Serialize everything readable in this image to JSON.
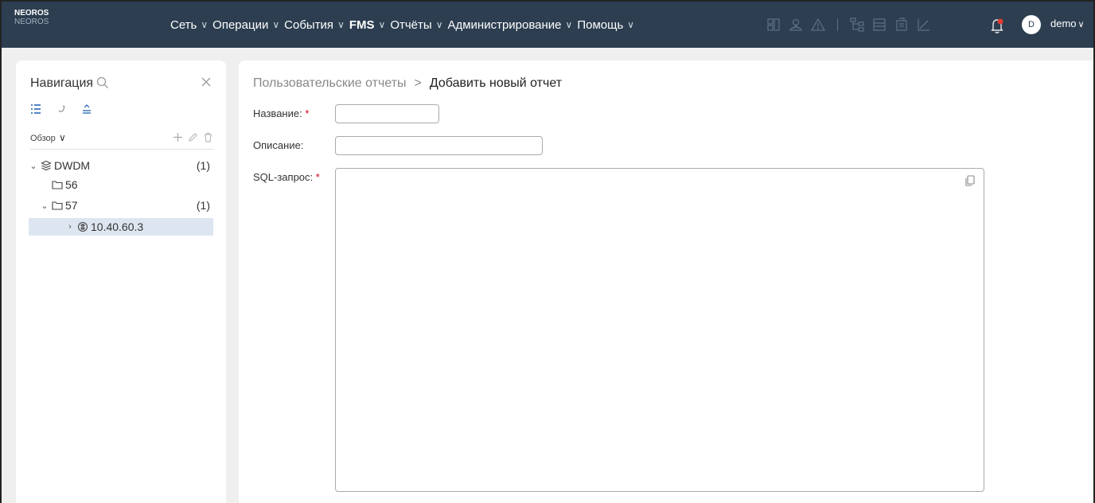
{
  "brand": {
    "title": "NEOROS",
    "subtitle": "NEOROS"
  },
  "menu": [
    {
      "label": "Сеть",
      "bold": false
    },
    {
      "label": "Операции",
      "bold": false
    },
    {
      "label": "События",
      "bold": false
    },
    {
      "label": "FMS",
      "bold": true
    },
    {
      "label": "Отчёты",
      "bold": false
    },
    {
      "label": "Администрирование",
      "bold": false
    },
    {
      "label": "Помощь",
      "bold": false
    }
  ],
  "user": {
    "avatar_letter": "D",
    "name": "demo"
  },
  "colors": {
    "topbar": "#2c3e50",
    "selected_row": "#dde6f0",
    "required": "#d0021b",
    "notification_dot": "#e53935"
  },
  "nav": {
    "title": "Навигация",
    "overview_label": "Обзор",
    "tree": [
      {
        "label": "DWDM",
        "count": "(1)",
        "icon": "database-icon",
        "expander": "⌄",
        "selected": false
      },
      {
        "label": "56",
        "count": "",
        "icon": "folder-icon",
        "expander": "",
        "selected": false
      },
      {
        "label": "57",
        "count": "(1)",
        "icon": "folder-icon",
        "expander": "⌄",
        "selected": false
      },
      {
        "label": "10.40.60.3",
        "count": "",
        "icon": "network-node-icon",
        "expander": "›",
        "selected": true
      }
    ]
  },
  "breadcrumb": {
    "parent": "Пользовательские отчеты",
    "separator": ">",
    "current": "Добавить новый отчет"
  },
  "form": {
    "name_label": "Название:",
    "name_value": "",
    "description_label": "Описание:",
    "description_value": "",
    "sql_label": "SQL-запрос:",
    "sql_value": "",
    "required_mark": "*"
  }
}
